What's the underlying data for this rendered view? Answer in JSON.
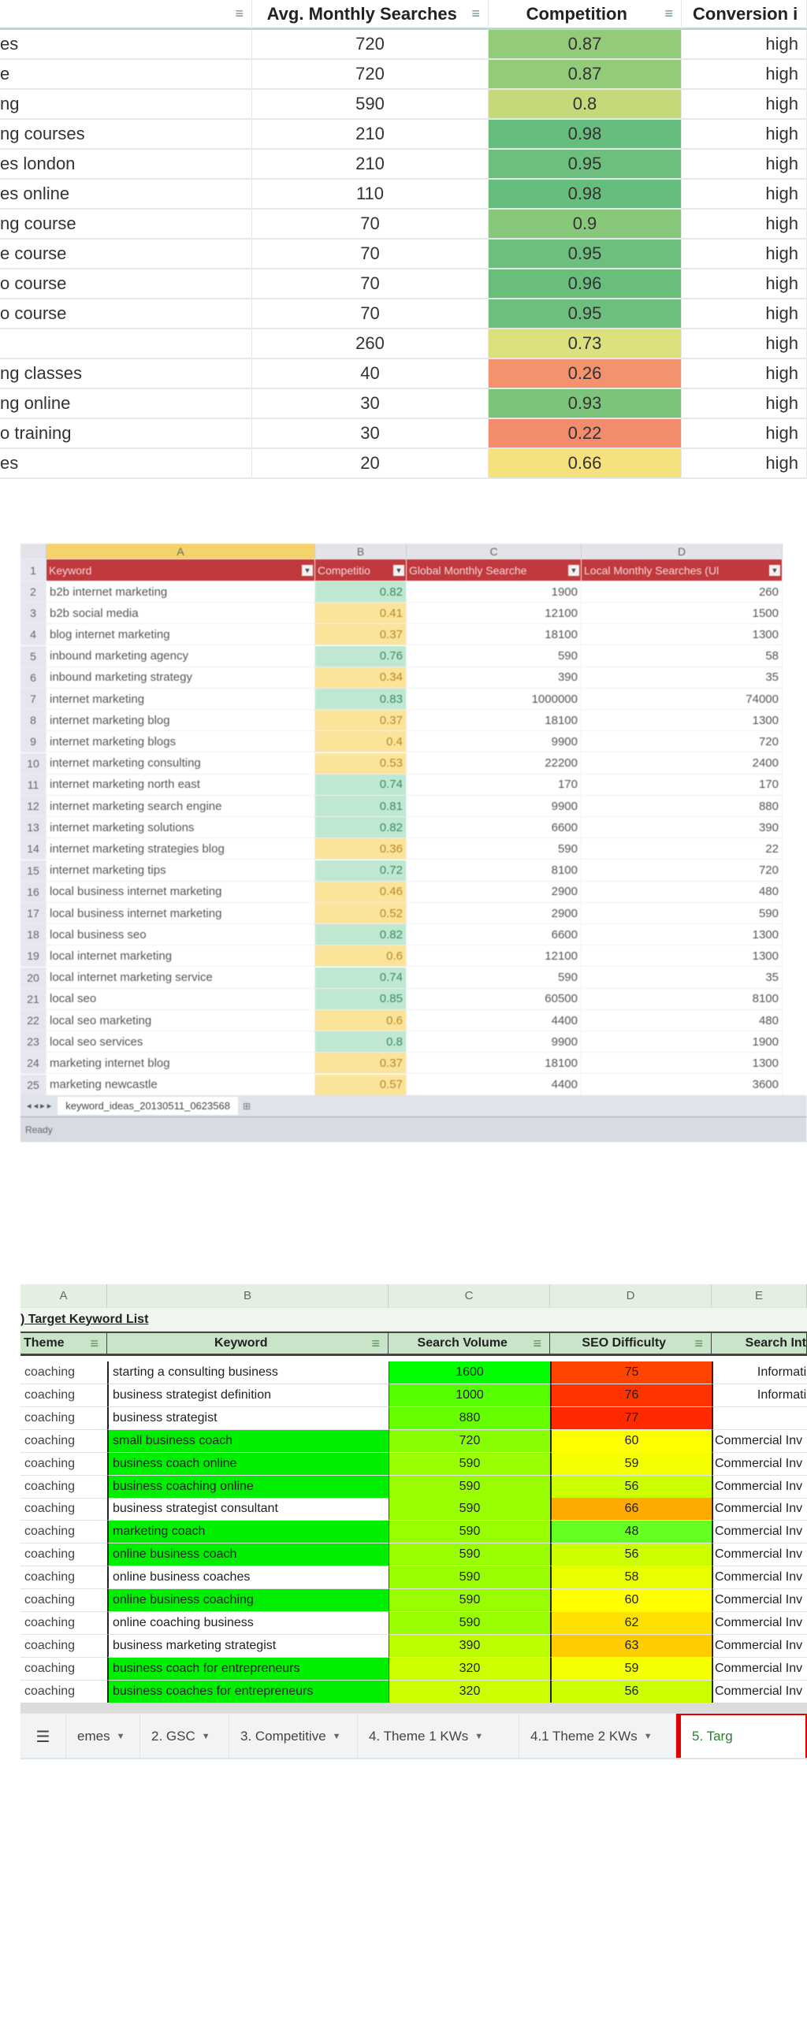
{
  "sheet1": {
    "headers": [
      "",
      "Avg. Monthly Searches",
      "Competition",
      "Conversion i"
    ],
    "rows": [
      [
        "es",
        "720",
        "0.87",
        "high",
        "#93cc78"
      ],
      [
        "e",
        "720",
        "0.87",
        "high",
        "#93cc78"
      ],
      [
        "ng",
        "590",
        "0.8",
        "high",
        "#c4d97a"
      ],
      [
        "ng courses",
        "210",
        "0.98",
        "high",
        "#67bd7c"
      ],
      [
        "es london",
        "210",
        "0.95",
        "high",
        "#6cbf7c"
      ],
      [
        "es online",
        "110",
        "0.98",
        "high",
        "#67bd7c"
      ],
      [
        "ng course",
        "70",
        "0.9",
        "high",
        "#88c87a"
      ],
      [
        "e course",
        "70",
        "0.95",
        "high",
        "#6cbf7c"
      ],
      [
        "o course",
        "70",
        "0.96",
        "high",
        "#6abe7c"
      ],
      [
        "o course",
        "70",
        "0.95",
        "high",
        "#6cbf7c"
      ],
      [
        "",
        "260",
        "0.73",
        "high",
        "#dce07e"
      ],
      [
        "ng classes",
        "40",
        "0.26",
        "high",
        "#f4926d"
      ],
      [
        "ng online",
        "30",
        "0.93",
        "high",
        "#7dc47b"
      ],
      [
        "o training",
        "30",
        "0.22",
        "high",
        "#f38b6d"
      ],
      [
        "es",
        "20",
        "0.66",
        "high",
        "#f5e27f"
      ]
    ]
  },
  "sheet2": {
    "columns": [
      "A",
      "B",
      "C",
      "D"
    ],
    "headers": [
      "Keyword",
      "Competitio",
      "Global Monthly Searche",
      "Local Monthly Searches (Ul"
    ],
    "header_color": "#c0393c",
    "rows": [
      [
        "2",
        "b2b internet marketing",
        "0.82",
        "1900",
        "260",
        "green"
      ],
      [
        "3",
        "b2b social media",
        "0.41",
        "12100",
        "1500",
        "yellow"
      ],
      [
        "4",
        "blog internet marketing",
        "0.37",
        "18100",
        "1300",
        "yellow"
      ],
      [
        "5",
        "inbound marketing agency",
        "0.76",
        "590",
        "58",
        "green"
      ],
      [
        "6",
        "inbound marketing strategy",
        "0.34",
        "390",
        "35",
        "yellow"
      ],
      [
        "7",
        "internet marketing",
        "0.83",
        "1000000",
        "74000",
        "green"
      ],
      [
        "8",
        "internet marketing blog",
        "0.37",
        "18100",
        "1300",
        "yellow"
      ],
      [
        "9",
        "internet marketing blogs",
        "0.4",
        "9900",
        "720",
        "yellow"
      ],
      [
        "10",
        "internet marketing consulting",
        "0.53",
        "22200",
        "2400",
        "yellow"
      ],
      [
        "11",
        "internet marketing north east",
        "0.74",
        "170",
        "170",
        "green"
      ],
      [
        "12",
        "internet marketing search engine",
        "0.81",
        "9900",
        "880",
        "green"
      ],
      [
        "13",
        "internet marketing solutions",
        "0.82",
        "6600",
        "390",
        "green"
      ],
      [
        "14",
        "internet marketing strategies blog",
        "0.36",
        "590",
        "22",
        "yellow"
      ],
      [
        "15",
        "internet marketing tips",
        "0.72",
        "8100",
        "720",
        "green"
      ],
      [
        "16",
        "local business internet marketing",
        "0.46",
        "2900",
        "480",
        "yellow"
      ],
      [
        "17",
        "local business internet marketing",
        "0.52",
        "2900",
        "590",
        "yellow"
      ],
      [
        "18",
        "local business seo",
        "0.82",
        "6600",
        "1300",
        "green"
      ],
      [
        "19",
        "local internet marketing",
        "0.6",
        "12100",
        "1300",
        "yellow"
      ],
      [
        "20",
        "local internet marketing service",
        "0.74",
        "590",
        "35",
        "green"
      ],
      [
        "21",
        "local seo",
        "0.85",
        "60500",
        "8100",
        "green"
      ],
      [
        "22",
        "local seo marketing",
        "0.6",
        "4400",
        "480",
        "yellow"
      ],
      [
        "23",
        "local seo services",
        "0.8",
        "9900",
        "1900",
        "green"
      ],
      [
        "24",
        "marketing internet blog",
        "0.37",
        "18100",
        "1300",
        "yellow"
      ],
      [
        "25",
        "marketing newcastle",
        "0.57",
        "4400",
        "3600",
        "yellow"
      ]
    ],
    "colors": {
      "green": "#bfe8d3",
      "yellow": "#fbe39a"
    },
    "sheet_tab": "keyword_ideas_20130511_0623568",
    "status": "Ready"
  },
  "sheet3": {
    "columns": [
      "A",
      "B",
      "C",
      "D",
      "E"
    ],
    "title": ") Target Keyword List",
    "headers": [
      "Theme",
      "Keyword",
      "Search Volume",
      "SEO Difficulty",
      "Search Int"
    ],
    "rows": [
      [
        "coaching",
        "starting a consulting business",
        "1600",
        "75",
        "Informati",
        false,
        "#00ff00",
        "#ff4400"
      ],
      [
        "coaching",
        "business strategist definition",
        "1000",
        "76",
        "Informati",
        false,
        "#55ff00",
        "#ff3300"
      ],
      [
        "coaching",
        "business strategist",
        "880",
        "77",
        "",
        false,
        "#66ff00",
        "#ff2a00"
      ],
      [
        "coaching",
        "small business coach",
        "720",
        "60",
        "Commercial Inv",
        true,
        "#88ff00",
        "#ffff00"
      ],
      [
        "coaching",
        "business coach online",
        "590",
        "59",
        "Commercial Inv",
        true,
        "#99ff00",
        "#f4ff00"
      ],
      [
        "coaching",
        "business coaching online",
        "590",
        "56",
        "Commercial Inv",
        true,
        "#99ff00",
        "#ccff00"
      ],
      [
        "coaching",
        "business strategist consultant",
        "590",
        "66",
        "Commercial Inv",
        false,
        "#99ff00",
        "#ffaa00"
      ],
      [
        "coaching",
        "marketing coach",
        "590",
        "48",
        "Commercial Inv",
        true,
        "#99ff00",
        "#66ff22"
      ],
      [
        "coaching",
        "online business coach",
        "590",
        "56",
        "Commercial Inv",
        true,
        "#99ff00",
        "#ccff00"
      ],
      [
        "coaching",
        "online business coaches",
        "590",
        "58",
        "Commercial Inv",
        false,
        "#99ff00",
        "#e8ff00"
      ],
      [
        "coaching",
        "online business coaching",
        "590",
        "60",
        "Commercial Inv",
        true,
        "#99ff00",
        "#ffff00"
      ],
      [
        "coaching",
        "online coaching business",
        "590",
        "62",
        "Commercial Inv",
        false,
        "#99ff00",
        "#ffe000"
      ],
      [
        "coaching",
        "business marketing strategist",
        "390",
        "63",
        "Commercial Inv",
        false,
        "#bbff00",
        "#ffcc00"
      ],
      [
        "coaching",
        "business coach for entrepreneurs",
        "320",
        "59",
        "Commercial Inv",
        true,
        "#ccff00",
        "#f4ff00"
      ],
      [
        "coaching",
        "business coaches for entrepreneurs",
        "320",
        "56",
        "Commercial Inv",
        true,
        "#ccff00",
        "#ccff00"
      ]
    ],
    "highlight_color": "#00ee00",
    "tabs": [
      "emes",
      "2. GSC",
      "3. Competitive",
      "4. Theme 1 KWs",
      "4.1 Theme 2 KWs",
      "5. Targ"
    ],
    "active_tab_color": "#2e7d32",
    "active_tab_border": "#e00000"
  }
}
